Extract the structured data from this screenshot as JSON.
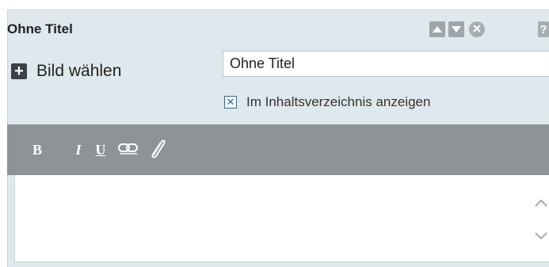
{
  "dialog": {
    "title": "Ohne Titel",
    "help_label": "?"
  },
  "image": {
    "add_label": "Bild wählen",
    "plus_symbol": "+"
  },
  "title_field": {
    "value": "Ohne Titel"
  },
  "toc_checkbox": {
    "label": "Im Inhaltsverzeichnis anzeigen",
    "checked": true,
    "mark": "✕"
  },
  "toolbar": {
    "bold": "B",
    "italic": "I",
    "underline": "U"
  },
  "colors": {
    "panel": "#dfe8ec",
    "toolbar": "#8e9396",
    "accent": "#2b6ea8"
  }
}
